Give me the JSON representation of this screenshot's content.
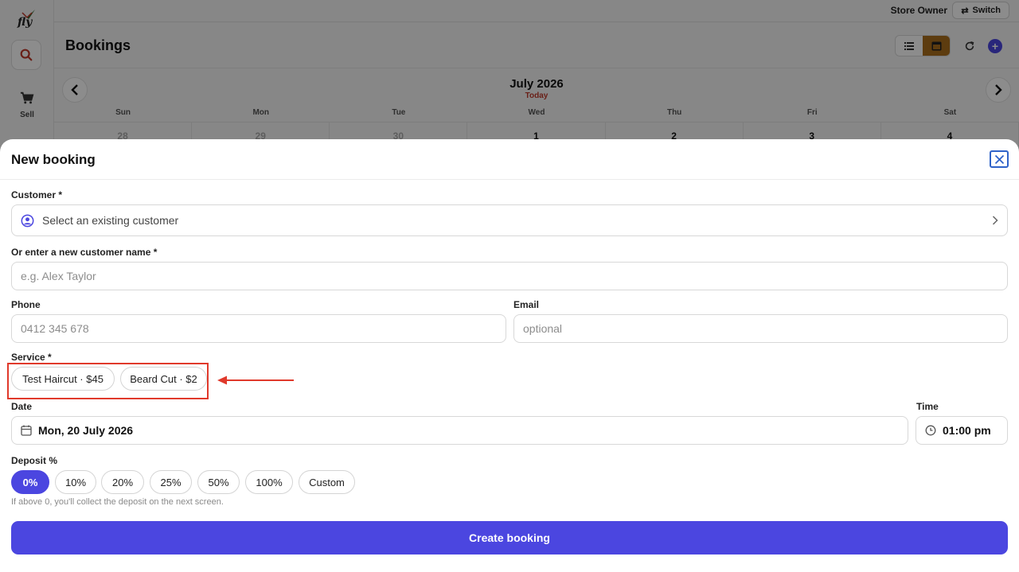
{
  "app": {
    "logo_text": "fly",
    "sidebar": {
      "sell_label": "Sell"
    },
    "topbar": {
      "role": "Store Owner",
      "switch_label": "Switch"
    },
    "page_title": "Bookings"
  },
  "calendar": {
    "month": "July 2026",
    "today_label": "Today",
    "weekdays": [
      "Sun",
      "Mon",
      "Tue",
      "Wed",
      "Thu",
      "Fri",
      "Sat"
    ],
    "first_row": [
      "28",
      "29",
      "30",
      "1",
      "2",
      "3",
      "4"
    ]
  },
  "modal": {
    "title": "New booking",
    "customer": {
      "label": "Customer *",
      "select_text": "Select an existing customer"
    },
    "new_customer": {
      "label": "Or enter a new customer name *",
      "placeholder": "e.g. Alex Taylor",
      "value": ""
    },
    "phone": {
      "label": "Phone",
      "placeholder": "0412 345 678",
      "value": ""
    },
    "email": {
      "label": "Email",
      "placeholder": "optional",
      "value": ""
    },
    "service": {
      "label": "Service *",
      "options": [
        "Test Haircut · $45",
        "Beard Cut · $2"
      ]
    },
    "date": {
      "label": "Date",
      "value": "Mon, 20 July 2026"
    },
    "time": {
      "label": "Time",
      "value": "01:00 pm"
    },
    "deposit": {
      "label": "Deposit %",
      "options": [
        "0%",
        "10%",
        "20%",
        "25%",
        "50%",
        "100%",
        "Custom"
      ],
      "selected": "0%",
      "hint": "If above 0, you'll collect the deposit on the next screen."
    },
    "submit_label": "Create booking"
  },
  "colors": {
    "accent": "#4b46e0",
    "highlight": "#e0392b",
    "active_view": "#a96e1c"
  }
}
